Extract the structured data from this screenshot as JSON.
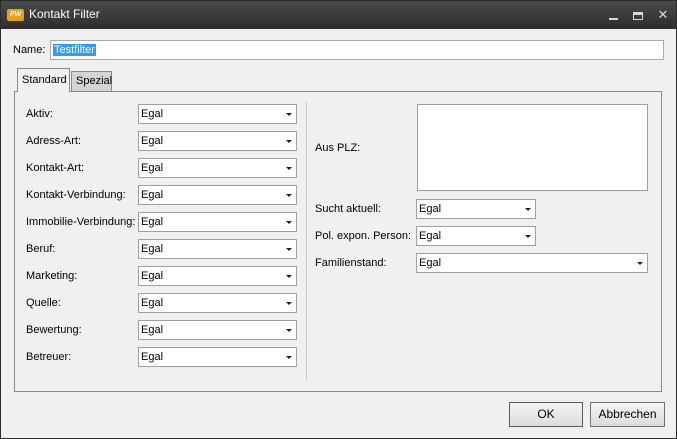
{
  "window": {
    "title": "Kontakt Filter",
    "app_icon_text": "PW",
    "controls": {
      "minimize": "minimize",
      "maximize": "maximize",
      "close": "✕"
    }
  },
  "name_field": {
    "label": "Name:",
    "value": "Testfilter"
  },
  "tabs": [
    {
      "label": "Standard",
      "active": true
    },
    {
      "label": "Spezial",
      "active": false
    }
  ],
  "left_fields": [
    {
      "label": "Aktiv:",
      "value": "Egal"
    },
    {
      "label": "Adress-Art:",
      "value": "Egal"
    },
    {
      "label": "Kontakt-Art:",
      "value": "Egal"
    },
    {
      "label": "Kontakt-Verbindung:",
      "value": "Egal"
    },
    {
      "label": "Immobilie-Verbindung:",
      "value": "Egal"
    },
    {
      "label": "Beruf:",
      "value": "Egal"
    },
    {
      "label": "Marketing:",
      "value": "Egal"
    },
    {
      "label": "Quelle:",
      "value": "Egal"
    },
    {
      "label": "Bewertung:",
      "value": "Egal"
    },
    {
      "label": "Betreuer:",
      "value": "Egal"
    }
  ],
  "right_fields": {
    "plz": {
      "label": "Aus PLZ:",
      "value": ""
    },
    "sucht_aktuell": {
      "label": "Sucht aktuell:",
      "value": "Egal"
    },
    "pep": {
      "label": "Pol. expon. Person:",
      "value": "Egal"
    },
    "familienstand": {
      "label": "Familienstand:",
      "value": "Egal"
    }
  },
  "buttons": {
    "ok": "OK",
    "cancel": "Abbrechen"
  }
}
